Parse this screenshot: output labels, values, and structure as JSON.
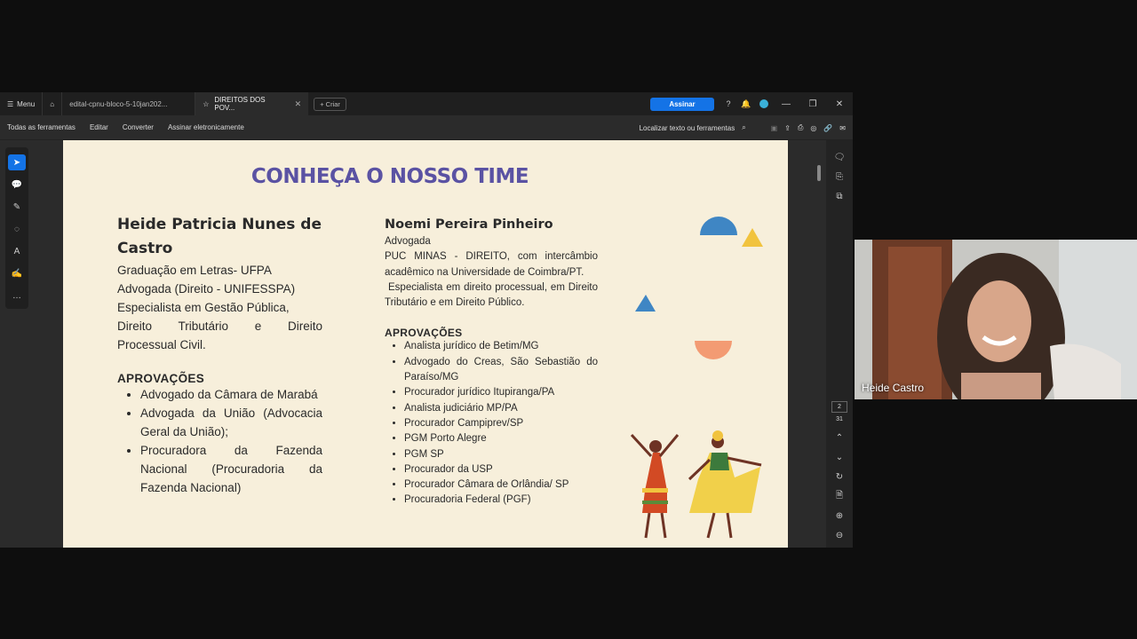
{
  "titlebar": {
    "menu_label": "Menu",
    "tabs": [
      {
        "label": "edital-cpnu-bloco-5-10jan202..."
      },
      {
        "label": "DIREITOS DOS POV..."
      }
    ],
    "new_tab_label": "Criar",
    "sign_button": "Assinar"
  },
  "toolbar": {
    "all_tools": "Todas as ferramentas",
    "edit": "Editar",
    "convert": "Converter",
    "sign_electronically": "Assinar eletronicamente",
    "search_label": "Localizar texto ou ferramentas"
  },
  "page_nav": {
    "current": "2",
    "total": "31"
  },
  "slide": {
    "title": "CONHEÇA O NOSSO TIME",
    "person1": {
      "name_line1": "Heide Patricia Nunes de",
      "name_line2": "Castro",
      "lines": [
        "Graduação em Letras- UFPA",
        "Advogada (Direito - UNIFESSPA)",
        "Especialista em Gestão Pública,",
        "Direito Tributário e Direito",
        "Processual Civil."
      ],
      "approvals_heading": "APROVAÇÕES",
      "approvals": [
        "Advogado da Câmara de Marabá",
        "Advogada da União (Advocacia Geral da União);",
        "Procuradora da Fazenda Nacional (Procuradoria da Fazenda Nacional)"
      ]
    },
    "person2": {
      "name": "Noemi Pereira Pinheiro",
      "role": "Advogada",
      "lines": [
        "PUC MINAS - DIREITO, com intercâmbio acadêmico na Universidade de Coimbra/PT.",
        "Especialista em direito processual, em Direito Tributário e em Direito Público."
      ],
      "approvals_heading": "APROVAÇÕES",
      "approvals": [
        "Analista jurídico de Betim/MG",
        "Advogado do Creas, São Sebastião do Paraíso/MG",
        "Procurador jurídico Itupiranga/PA",
        "Analista judiciário MP/PA",
        "Procurador Campiprev/SP",
        "PGM Porto Alegre",
        "PGM SP",
        "Procurador da USP",
        "Procurador Câmara de Orlândia/ SP",
        "Procuradoria Federal (PGF)"
      ]
    }
  },
  "video": {
    "participant_name": "Heide Castro"
  },
  "colors": {
    "accent": "#1473e6",
    "slide_bg": "#f7efdb",
    "title": "#5a52a3"
  }
}
